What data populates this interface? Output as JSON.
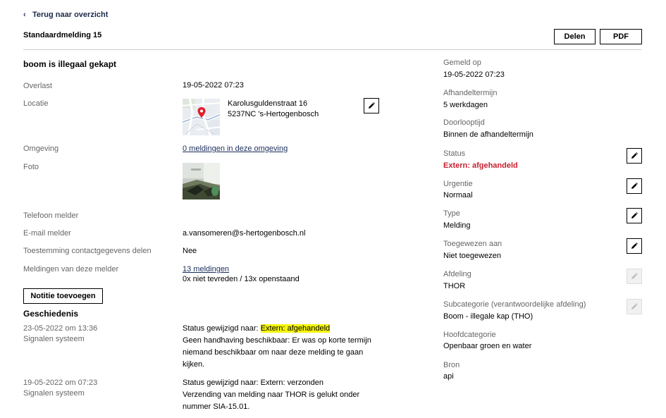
{
  "nav": {
    "back_label": "Terug naar overzicht"
  },
  "header": {
    "title": "Standaardmelding 15",
    "share_label": "Delen",
    "pdf_label": "PDF"
  },
  "main": {
    "heading": "boom is illegaal gekapt",
    "overlast_label": "Overlast",
    "overlast_value": "19-05-2022 07:23",
    "locatie_label": "Locatie",
    "locatie_line1": "Karolusguldenstraat 16",
    "locatie_line2": "5237NC 's-Hertogenbosch",
    "omgeving_label": "Omgeving",
    "omgeving_link": "0 meldingen in deze omgeving",
    "foto_label": "Foto",
    "telefoon_label": "Telefoon melder",
    "email_label": "E-mail melder",
    "email_value": "a.vansomeren@s-hertogenbosch.nl",
    "toestemming_label": "Toestemming contactgegevens delen",
    "toestemming_value": "Nee",
    "meldingen_label": "Meldingen van deze melder",
    "meldingen_link": "13 meldingen",
    "meldingen_summary": "0x niet tevreden / 13x openstaand",
    "note_button": "Notitie toevoegen"
  },
  "history": {
    "heading": "Geschiedenis",
    "entries": [
      {
        "date": "23-05-2022 om 13:36",
        "author": "Signalen systeem",
        "status_prefix": "Status gewijzigd naar: ",
        "status_value": "Extern: afgehandeld",
        "lines": [
          "Geen handhaving beschikbaar: Er was op korte termijn",
          "niemand beschikbaar om naar deze melding te gaan",
          "kijken."
        ]
      },
      {
        "date": "19-05-2022 om 07:23",
        "author": "Signalen systeem",
        "status_prefix": "Status gewijzigd naar: ",
        "status_value": "Extern: verzonden",
        "lines": [
          "Verzending van melding naar THOR is gelukt onder",
          "nummer SIA-15.01."
        ]
      }
    ]
  },
  "sidebar": {
    "gemeld_label": "Gemeld op",
    "gemeld_value": "19-05-2022 07:23",
    "afhandel_label": "Afhandeltermijn",
    "afhandel_value": "5 werkdagen",
    "doorloop_label": "Doorlooptijd",
    "doorloop_value": "Binnen de afhandeltermijn",
    "status_label": "Status",
    "status_value": "Extern: afgehandeld",
    "urgentie_label": "Urgentie",
    "urgentie_value": "Normaal",
    "type_label": "Type",
    "type_value": "Melding",
    "toegewezen_label": "Toegewezen aan",
    "toegewezen_value": "Niet toegewezen",
    "afdeling_label": "Afdeling",
    "afdeling_value": "THOR",
    "subcategorie_label": "Subcategorie (verantwoordelijke afdeling)",
    "subcategorie_value": "Boom - illegale kap (THO)",
    "hoofdcategorie_label": "Hoofdcategorie",
    "hoofdcategorie_value": "Openbaar groen en water",
    "bron_label": "Bron",
    "bron_value": "api"
  },
  "icons": {
    "back": "chevron-left-icon",
    "edit": "pencil-icon",
    "map_marker": "map-marker-icon"
  },
  "colors": {
    "status_red": "#c8202f",
    "link_navy": "#1a2d5a",
    "highlight_yellow": "#f5f50a",
    "label_gray": "#666666"
  }
}
